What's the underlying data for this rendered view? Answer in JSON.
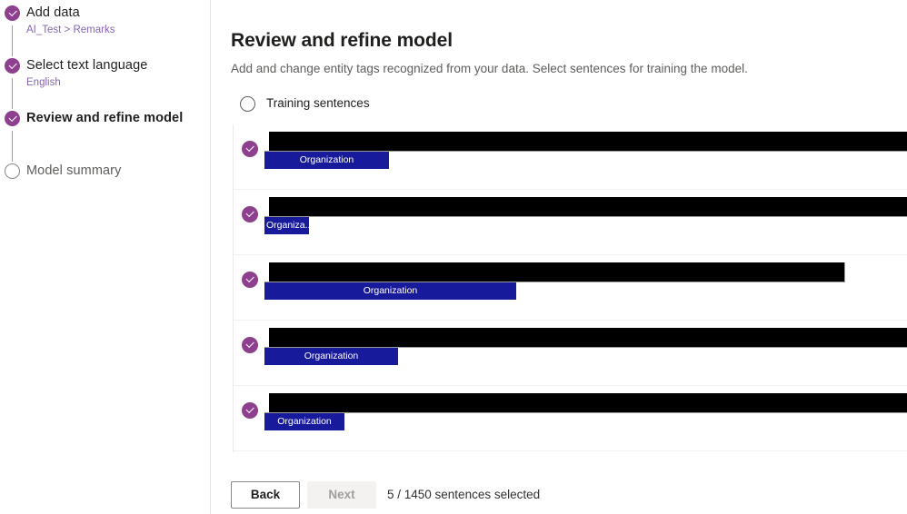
{
  "sidebar": {
    "steps": [
      {
        "label": "Add data",
        "state": "done",
        "sub_prefix": "AI_Test",
        "sub_sep": " > ",
        "sub_suffix": "Remarks",
        "sub_full": "AI_Test > Remarks"
      },
      {
        "label": "Select text language",
        "state": "done",
        "sub_full": "English"
      },
      {
        "label": "Review and refine model",
        "state": "done",
        "sub_full": ""
      },
      {
        "label": "Model summary",
        "state": "todo",
        "sub_full": ""
      }
    ]
  },
  "main": {
    "title": "Review and refine model",
    "subtitle": "Add and change entity tags recognized from your data. Select sentences for training the model.",
    "select_all_label": "Training sentences",
    "rows": [
      {
        "tag_label": "Organization"
      },
      {
        "tag_label": "Organiza..."
      },
      {
        "tag_label": "Organization"
      },
      {
        "tag_label": "Organization"
      },
      {
        "tag_label": "Organization"
      }
    ]
  },
  "footer": {
    "back_label": "Back",
    "next_label": "Next",
    "status": "5 / 1450 sentences selected"
  },
  "colors": {
    "accent_purple": "#8e3f8e",
    "link_purple": "#8764b8",
    "tag_blue": "#181a9c",
    "redaction_black": "#000000",
    "divider": "#edebe9"
  }
}
